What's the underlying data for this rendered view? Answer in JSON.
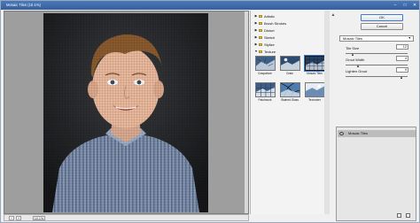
{
  "window": {
    "title": "Mosaic Tiles (10.1%)",
    "minimize": "–",
    "maximize": "□",
    "close": "✕"
  },
  "status": {
    "zoom_minus": "−",
    "zoom_plus": "+",
    "zoom": "10.1%"
  },
  "gallery": {
    "folders": [
      {
        "label": "Artistic",
        "expanded": false
      },
      {
        "label": "Brush Strokes",
        "expanded": false
      },
      {
        "label": "Distort",
        "expanded": false
      },
      {
        "label": "Sketch",
        "expanded": false
      },
      {
        "label": "Stylize",
        "expanded": false
      },
      {
        "label": "Texture",
        "expanded": true
      }
    ],
    "thumbnails": [
      {
        "label": "Craquelure",
        "selected": false
      },
      {
        "label": "Grain",
        "selected": false
      },
      {
        "label": "Mosaic Tiles",
        "selected": true
      },
      {
        "label": "Patchwork",
        "selected": false
      },
      {
        "label": "Stained Glass",
        "selected": false
      },
      {
        "label": "Texturizer",
        "selected": false
      }
    ],
    "collapse": "▲"
  },
  "buttons": {
    "ok": "OK",
    "cancel": "Cancel"
  },
  "filter": {
    "selected": "Mosaic Tiles"
  },
  "params": [
    {
      "label": "Tile Size",
      "value": "12",
      "level": 0.12
    },
    {
      "label": "Grout Width",
      "value": "4",
      "level": 0.2
    },
    {
      "label": "Lighten Grout",
      "value": "9",
      "level": 0.9
    }
  ],
  "layers": {
    "active": "Mosaic Tiles"
  },
  "colors": {
    "titlebar": "#3c6bab",
    "accent": "#3d7ad6",
    "photo_bg": "#1e1f22",
    "shirt": "#7d8ea8"
  }
}
